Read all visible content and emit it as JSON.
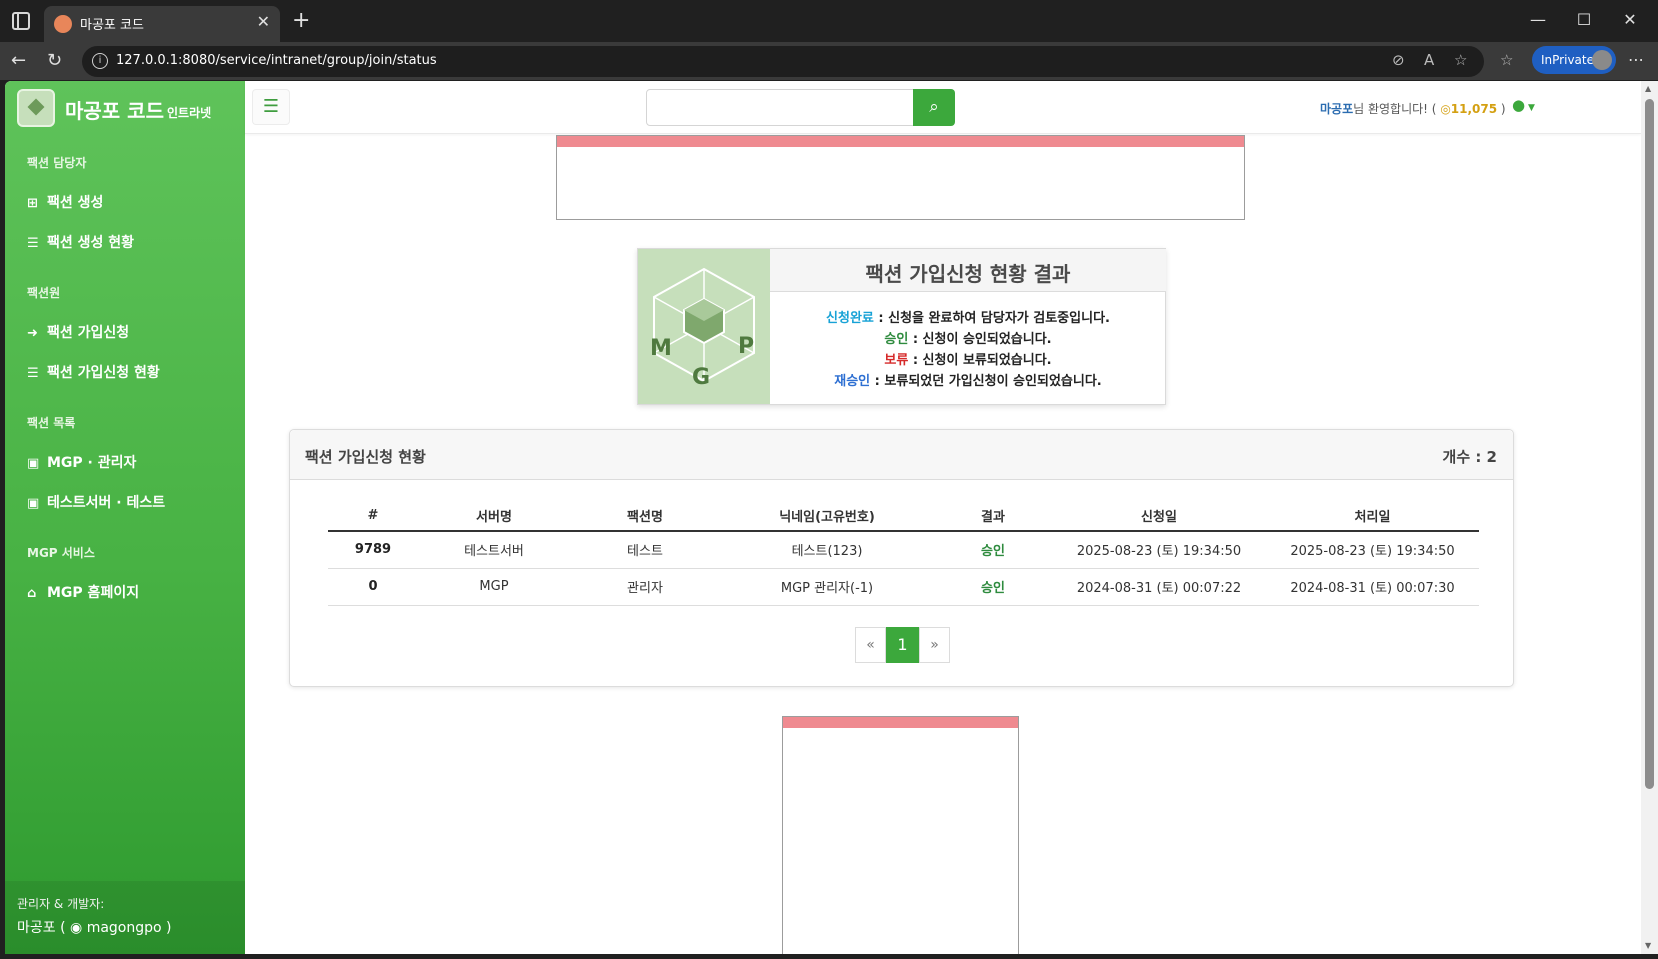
{
  "browser": {
    "tab_title": "마공포 코드",
    "url": "127.0.0.1:8080/service/intranet/group/join/status",
    "inprivate_label": "InPrivate"
  },
  "sidebar": {
    "brand_name": "마공포 코드",
    "brand_sub": "인트라넷",
    "sections": [
      {
        "heading": "팩션 담당자",
        "items": [
          {
            "label": "팩션 생성",
            "icon": "plus-square-icon"
          },
          {
            "label": "팩션 생성 현황",
            "icon": "list-check-icon"
          }
        ]
      },
      {
        "heading": "팩션원",
        "items": [
          {
            "label": "팩션 가입신청",
            "icon": "sign-in-icon"
          },
          {
            "label": "팩션 가입신청 현황",
            "icon": "list-check-icon"
          }
        ]
      },
      {
        "heading": "팩션 목록",
        "items": [
          {
            "label": "MGP · 관리자",
            "icon": "briefcase-icon"
          },
          {
            "label": "테스트서버 · 테스트",
            "icon": "briefcase-icon"
          }
        ]
      },
      {
        "heading": "MGP 서비스",
        "items": [
          {
            "label": "MGP 홈페이지",
            "icon": "home-icon"
          }
        ]
      }
    ],
    "footer_label": "관리자 & 개발자:",
    "footer_name": "마공포 ( ",
    "footer_discord": "magongpo",
    "footer_close": " )"
  },
  "topbar": {
    "search_placeholder": "",
    "welcome_nick": "마공포",
    "welcome_text": "님 환영합니다! ( ",
    "coins": "11,075",
    "welcome_close": " )"
  },
  "legend": {
    "title": "팩션 가입신청 현황 결과",
    "lines": [
      {
        "key": "신청완료",
        "color": "#17a2d6",
        "desc": " : 신청을 완료하여 담당자가 검토중입니다."
      },
      {
        "key": "승인",
        "color": "#2e8b3e",
        "desc": " : 신청이 승인되었습니다."
      },
      {
        "key": "보류",
        "color": "#d62a2a",
        "desc": " : 신청이 보류되었습니다."
      },
      {
        "key": "재승인",
        "color": "#2d6fd2",
        "desc": " : 보류되었던 가입신청이 승인되었습니다."
      }
    ],
    "logo_letters": [
      "M",
      "G",
      "P"
    ]
  },
  "table_card": {
    "title": "팩션 가입신청 현황",
    "count": "개수 : 2",
    "columns": [
      "#",
      "서버명",
      "팩션명",
      "닉네임(고유번호)",
      "결과",
      "신청일",
      "처리일"
    ],
    "rows": [
      [
        "9789",
        "테스트서버",
        "테스트",
        "테스트(123)",
        "승인",
        "2025-08-23 (토) 19:34:50",
        "2025-08-23 (토) 19:34:50"
      ],
      [
        "0",
        "MGP",
        "관리자",
        "MGP 관리자(-1)",
        "승인",
        "2024-08-31 (토) 00:07:22",
        "2024-08-31 (토) 00:07:30"
      ]
    ],
    "pager": {
      "prev": "«",
      "current": "1",
      "next": "»"
    }
  },
  "colors": {
    "accent": "#3ca83c",
    "sidebar_top": "#5fc35a",
    "sidebar_bottom": "#2e9a2f",
    "ad_bar": "#ef8a90"
  }
}
